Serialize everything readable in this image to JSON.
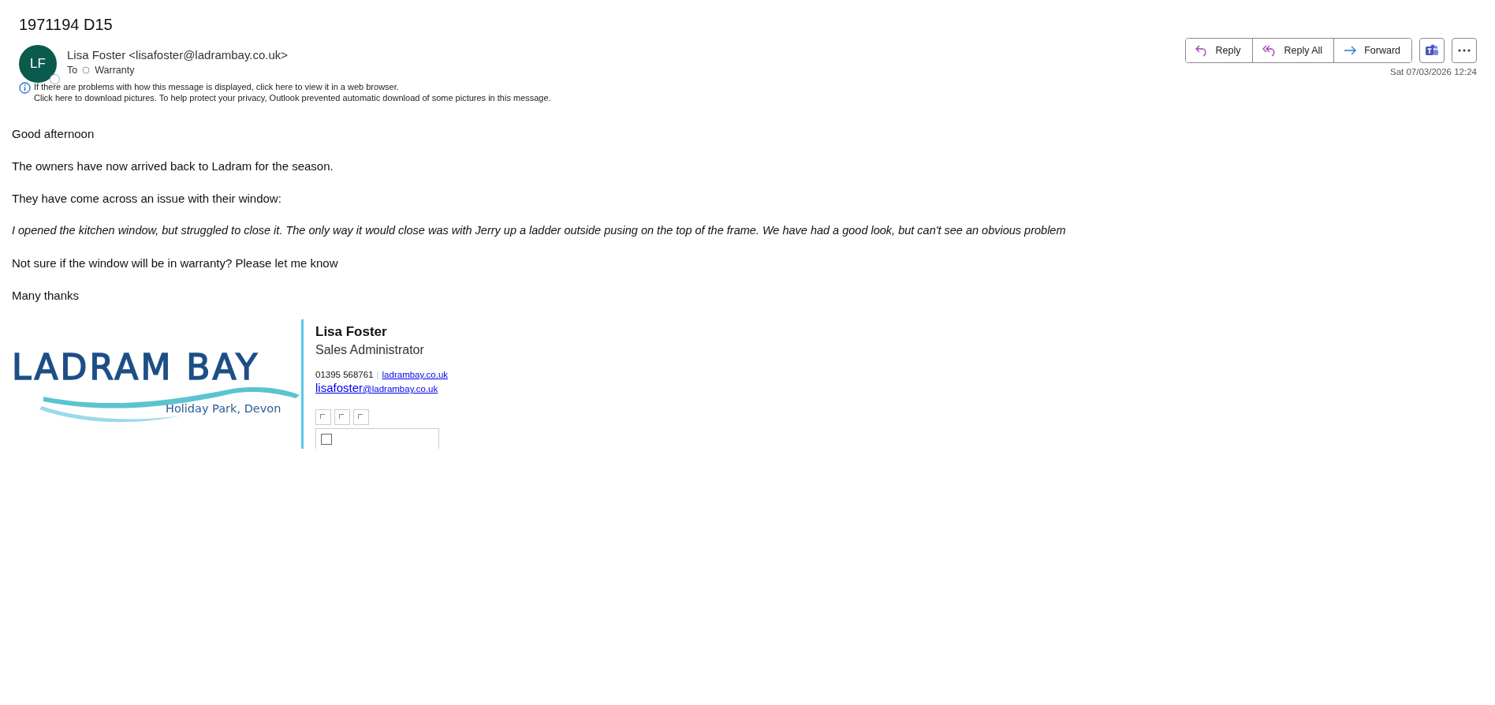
{
  "subject": "1971194  D15",
  "sender": {
    "initials": "LF",
    "name": "Lisa Foster <lisafoster@ladrambay.co.uk>",
    "to_label": "To",
    "to": "Warranty"
  },
  "actions": [
    {
      "label": "Reply",
      "kind": "reply"
    },
    {
      "label": "Reply All",
      "kind": "replyall"
    },
    {
      "label": "Forward",
      "kind": "forward"
    }
  ],
  "date": "Sat 07/03/2026 12:24",
  "info": [
    "If there are problems with how this message is displayed, click here to view it in a web browser.",
    "Click here to download pictures. To help protect your privacy, Outlook prevented automatic download of some pictures in this message."
  ],
  "body": [
    {
      "text": "Good afternoon",
      "italic": false
    },
    {
      "text": "The owners have now arrived back to Ladram for the season.",
      "italic": false
    },
    {
      "text": "They have come across an issue with their window:",
      "italic": false
    },
    {
      "text": "I opened the kitchen window, but struggled to close it. The only way it would close was with Jerry up a ladder outside pusing on the top of the frame. We have had a good look, but can't see an obvious problem",
      "italic": true
    },
    {
      "text": "Not sure if the window will be in warranty? Please let me know",
      "italic": false
    },
    {
      "text": "Many thanks",
      "italic": false
    }
  ],
  "signature": {
    "logo_title": "LADRAM BAY",
    "logo_subtitle": "Holiday Park, Devon",
    "name": "Lisa Foster",
    "role": "Sales Administrator",
    "phone": "01395 568761",
    "separator": "|",
    "website": "ladrambay.co.uk",
    "email_user": "lisafoster",
    "email_domain": "@ladrambay.co.uk"
  }
}
